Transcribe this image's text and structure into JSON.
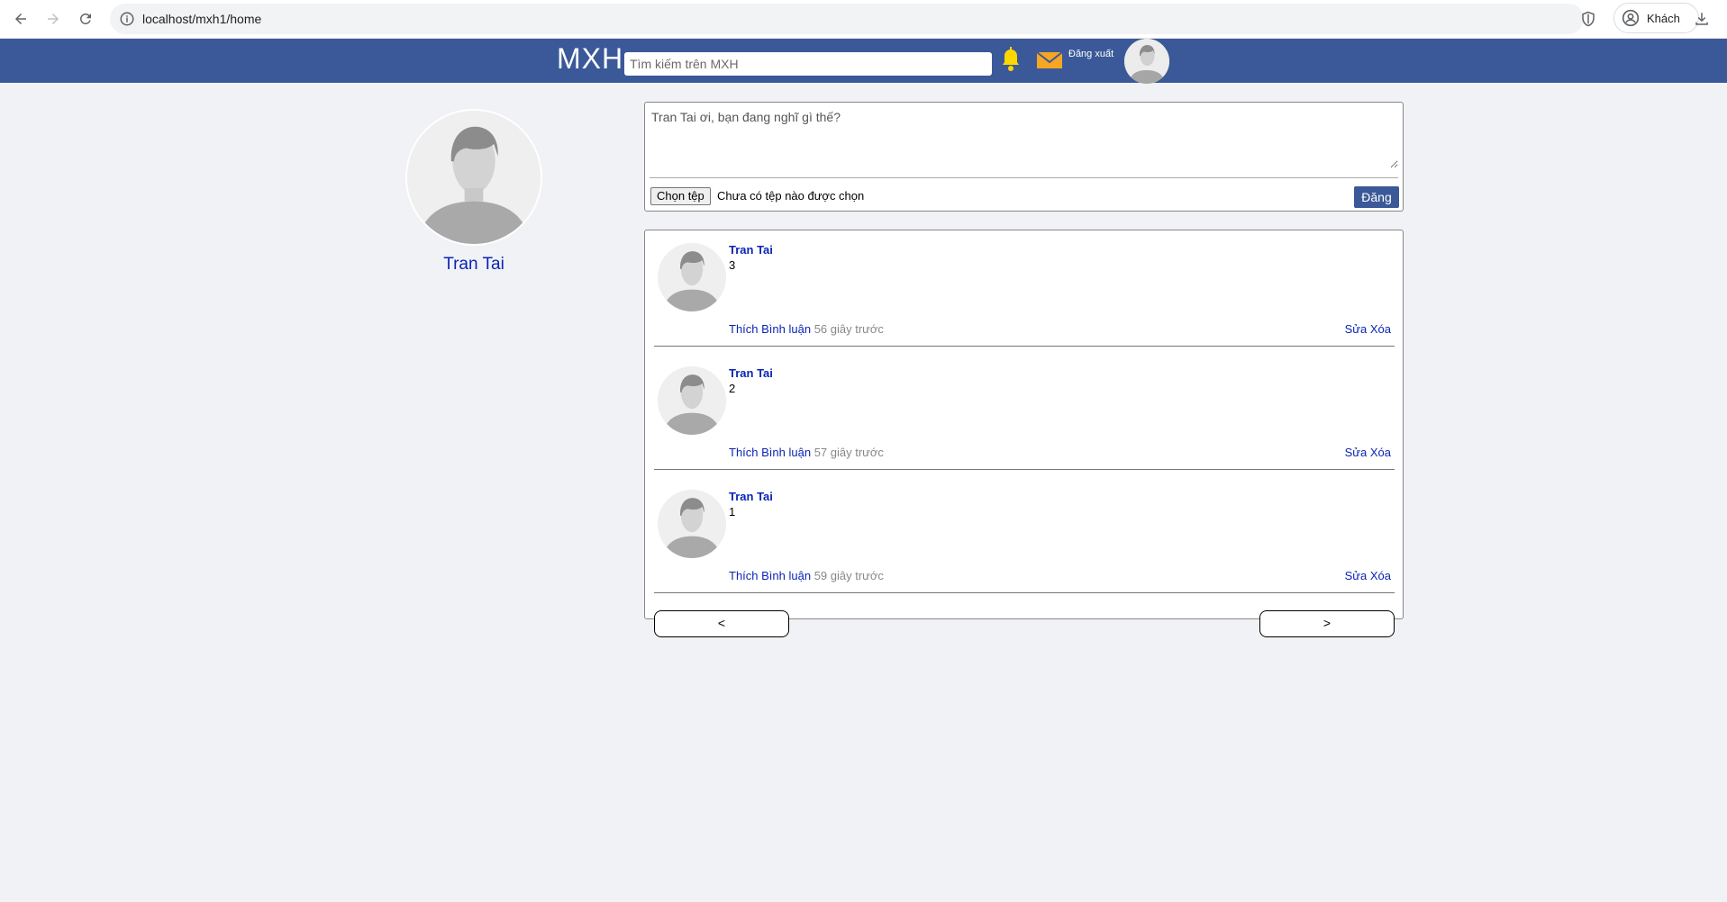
{
  "browser": {
    "url": "localhost/mxh1/home",
    "profile_label": "Khách"
  },
  "header": {
    "brand": "MXH",
    "search_placeholder": "Tìm kiếm trên MXH",
    "logout_label": "Đăng xuất",
    "accent_color": "#3b5998",
    "bell_color": "#ffd700",
    "mail_color": "#f5a623"
  },
  "profile": {
    "name": "Tran Tai"
  },
  "composer": {
    "placeholder": "Tran Tai ơi, bạn đang nghĩ gì thế?",
    "file_button_label": "Chọn tệp",
    "file_status": "Chưa có tệp nào được chọn",
    "post_button_label": "Đăng"
  },
  "feed": {
    "posts": [
      {
        "author": "Tran Tai",
        "content": "3",
        "like_label": "Thích",
        "comment_label": "Bình luận",
        "time": "56 giây trước",
        "edit_label": "Sửa",
        "delete_label": "Xóa"
      },
      {
        "author": "Tran Tai",
        "content": "2",
        "like_label": "Thích",
        "comment_label": "Bình luận",
        "time": "57 giây trước",
        "edit_label": "Sửa",
        "delete_label": "Xóa"
      },
      {
        "author": "Tran Tai",
        "content": "1",
        "like_label": "Thích",
        "comment_label": "Bình luận",
        "time": "59 giây trước",
        "edit_label": "Sửa",
        "delete_label": "Xóa"
      }
    ],
    "prev_label": "<",
    "next_label": ">"
  }
}
